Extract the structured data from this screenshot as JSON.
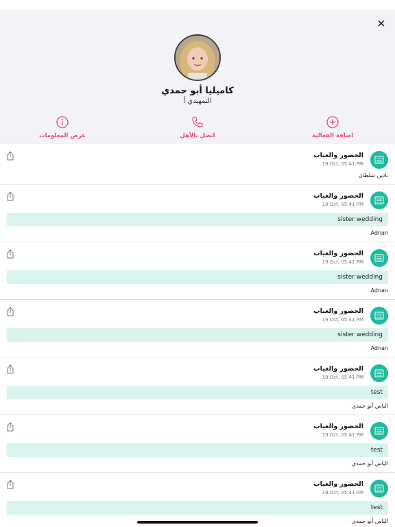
{
  "profile": {
    "name": "كاميليا أبو حمدي",
    "grade": "التمهيدي أ"
  },
  "actions": [
    {
      "label": "عرض المعلومات",
      "icon": "info-icon"
    },
    {
      "label": "اتصل بالأهل",
      "icon": "phone-icon"
    },
    {
      "label": "اضافة الفعالية",
      "icon": "plus-circle-icon"
    }
  ],
  "colors": {
    "accent": "#e4477e",
    "teal": "#1fbaa0",
    "note_bg": "#d9f4ee"
  },
  "feed": [
    {
      "title": "الحضور والغياب",
      "time": "19 Oct, 05:41 PM",
      "note": "",
      "author": "نادين سلطان"
    },
    {
      "title": "الحضور والغياب",
      "time": "19 Oct, 05:41 PM",
      "note": "sister wedding",
      "author": "Adnan"
    },
    {
      "title": "الحضور والغياب",
      "time": "19 Oct, 05:41 PM",
      "note": "sister wedding",
      "author": "Adnan"
    },
    {
      "title": "الحضور والغياب",
      "time": "19 Oct, 05:41 PM",
      "note": "sister wedding",
      "author": "Adnan"
    },
    {
      "title": "الحضور والغياب",
      "time": "19 Oct, 05:41 PM",
      "note": "test",
      "author": "الياس  أبو حمدي"
    },
    {
      "title": "الحضور والغياب",
      "time": "19 Oct, 05:41 PM",
      "note": "test",
      "author": "الياس  أبو حمدي"
    },
    {
      "title": "الحضور والغياب",
      "time": "19 Oct, 05:41 PM",
      "note": "test",
      "author": "الياس  أبو حمدي"
    }
  ]
}
